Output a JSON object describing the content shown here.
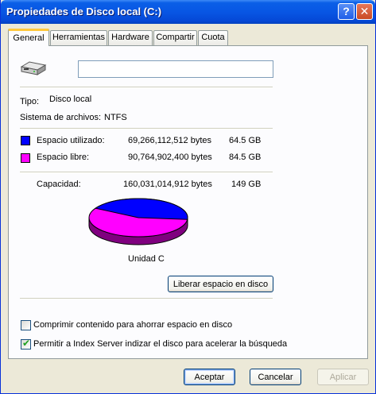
{
  "window": {
    "title": "Propiedades de Disco local (C:)",
    "help_glyph": "?",
    "close_glyph": "✕"
  },
  "tabs": [
    {
      "label": "General",
      "active": true
    },
    {
      "label": "Herramientas",
      "active": false
    },
    {
      "label": "Hardware",
      "active": false
    },
    {
      "label": "Compartir",
      "active": false
    },
    {
      "label": "Cuota",
      "active": false
    }
  ],
  "general": {
    "drive_icon": "hard-drive-icon",
    "name_value": "",
    "type_label": "Tipo:",
    "type_value": "Disco local",
    "fs_label": "Sistema de archivos:",
    "fs_value": "NTFS",
    "used_label": "Espacio utilizado:",
    "used_bytes": "69,266,112,512 bytes",
    "used_gb": "64.5 GB",
    "free_label": "Espacio libre:",
    "free_bytes": "90,764,902,400 bytes",
    "free_gb": "84.5 GB",
    "capacity_label": "Capacidad:",
    "capacity_bytes": "160,031,014,912 bytes",
    "capacity_gb": "149 GB",
    "drive_label": "Unidad C",
    "cleanup_button": "Liberar espacio en disco",
    "compress_label": "Comprimir contenido para ahorrar espacio en disco",
    "compress_checked": false,
    "index_label": "Permitir a Index Server indizar el disco para acelerar la búsqueda",
    "index_checked": true
  },
  "colors": {
    "used": "#0000ff",
    "free": "#ff00ff",
    "used_dark": "#00007f",
    "free_dark": "#7f007f"
  },
  "usage": {
    "used_fraction": 0.4328
  },
  "buttons": {
    "ok": "Aceptar",
    "cancel": "Cancelar",
    "apply": "Aplicar"
  }
}
